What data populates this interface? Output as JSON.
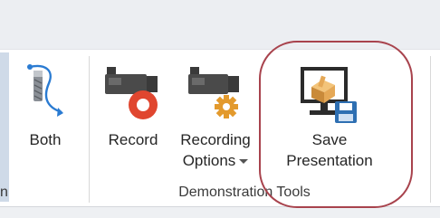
{
  "ribbon": {
    "partial_group_label": "n",
    "buttons": {
      "both": {
        "label": "Both",
        "icon": "curved-path-arrow-icon"
      },
      "record": {
        "label": "Record",
        "icon": "video-camera-record-icon"
      },
      "recording_options": {
        "label_line1": "Recording",
        "label_line2": "Options",
        "icon": "video-camera-gear-icon",
        "has_dropdown": true
      },
      "save_presentation": {
        "label_line1": "Save",
        "label_line2": "Presentation",
        "icon": "monitor-save-icon"
      }
    },
    "group": {
      "label": "Demonstration Tools"
    }
  },
  "annotation": {
    "highlight_color": "#a8434d"
  },
  "colors": {
    "record_red": "#e0462f",
    "gear_orange": "#e39a2d",
    "save_blue": "#2e6fb2",
    "path_blue": "#2a7bd2"
  }
}
